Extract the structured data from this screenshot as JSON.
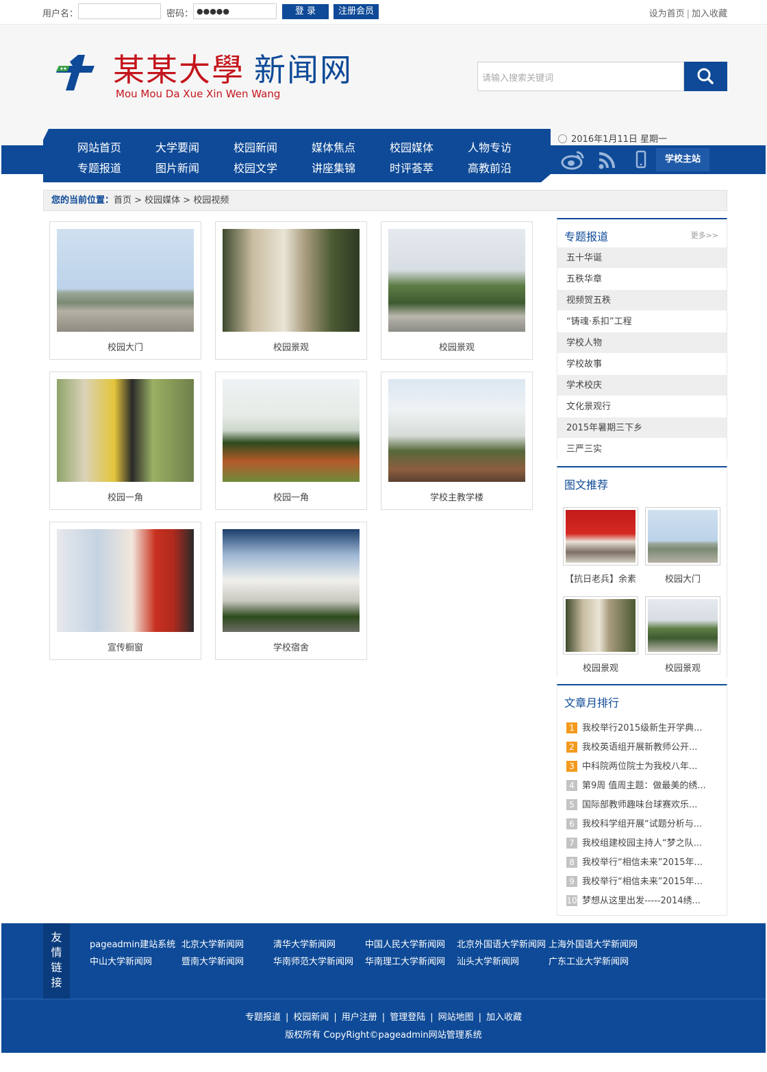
{
  "topbar": {
    "username_label": "用户名：",
    "password_label": "密码：",
    "password_value": "●●●●●",
    "login_button": "登 录",
    "register_button": "注册会员",
    "set_home": "设为首页",
    "separator": "|",
    "add_favorite": "加入收藏"
  },
  "header": {
    "logo_cn_red": "某某大學",
    "logo_cn_blue": "新闻网",
    "logo_en": "Mou Mou Da Xue Xin Wen Wang",
    "search_placeholder": "请输入搜索关键词"
  },
  "nav": {
    "row1": [
      "网站首页",
      "大学要闻",
      "校园新闻",
      "媒体焦点",
      "校园媒体",
      "人物专访"
    ],
    "row2": [
      "专题报道",
      "图片新闻",
      "校园文学",
      "讲座集锦",
      "时评荟萃",
      "高教前沿"
    ],
    "date": "2016年1月11日 星期一",
    "school_main": "学校主站"
  },
  "breadcrumb": {
    "label": "您的当前位置：",
    "path": "首页 > 校园媒体 > 校园视频"
  },
  "gallery": [
    {
      "caption": "校园大门"
    },
    {
      "caption": "校园景观"
    },
    {
      "caption": "校园景观"
    },
    {
      "caption": "校园一角"
    },
    {
      "caption": "校园一角"
    },
    {
      "caption": "学校主教学楼"
    },
    {
      "caption": "宣传橱窗"
    },
    {
      "caption": "学校宿舍"
    }
  ],
  "sidebar": {
    "topics_title": "专题报道",
    "more": "更多>>",
    "topics": [
      "五十华诞",
      "五秩华章",
      "视频贺五秩",
      "“铸魂·系扣”工程",
      "学校人物",
      "学校故事",
      "学术校庆",
      "文化景观行",
      "2015年暑期三下乡",
      "三严三实"
    ],
    "pics_title": "图文推荐",
    "pics": [
      "【抗日老兵】余素",
      "校园大门",
      "校园景观",
      "校园景观"
    ],
    "rank_title": "文章月排行",
    "rank": [
      {
        "num": "1",
        "title": "我校举行2015级新生开学典..."
      },
      {
        "num": "2",
        "title": "我校英语组开展新教师公开..."
      },
      {
        "num": "3",
        "title": "中科院两位院士为我校八年..."
      },
      {
        "num": "4",
        "title": "第9周 值周主题：做最美的绣..."
      },
      {
        "num": "5",
        "title": "国际部教师趣味台球赛欢乐..."
      },
      {
        "num": "6",
        "title": "我校科学组开展“试题分析与..."
      },
      {
        "num": "7",
        "title": "我校组建校园主持人“梦之队..."
      },
      {
        "num": "8",
        "title": "我校举行“相信未来”2015年..."
      },
      {
        "num": "9",
        "title": "我校举行“相信未来”2015年..."
      },
      {
        "num": "10",
        "title": "梦想从这里出发-----2014绣..."
      }
    ]
  },
  "links": {
    "head": [
      "友",
      "情",
      "链",
      "接"
    ],
    "row1": [
      "pageadmin建站系统",
      "北京大学新闻网",
      "清华大学新闻网",
      "中国人民大学新闻网",
      "北京外国语大学新闻网",
      "上海外国语大学新闻网"
    ],
    "row2": [
      "中山大学新闻网",
      "暨南大学新闻网",
      "华南师范大学新闻网",
      "华南理工大学新闻网",
      "汕头大学新闻网",
      "广东工业大学新闻网"
    ]
  },
  "footer": {
    "nav": [
      "专题报道",
      "校园新闻",
      "用户注册",
      "管理登陆",
      "网站地图",
      "加入收藏"
    ],
    "bar": "|",
    "copyright": "版权所有 CopyRight©pageadmin网站管理系统"
  },
  "colors": {
    "brand_blue": "#0e4a97",
    "brand_red": "#c4151c",
    "rank_hot": "#f39a1d",
    "rank_normal": "#c3c3c3"
  }
}
